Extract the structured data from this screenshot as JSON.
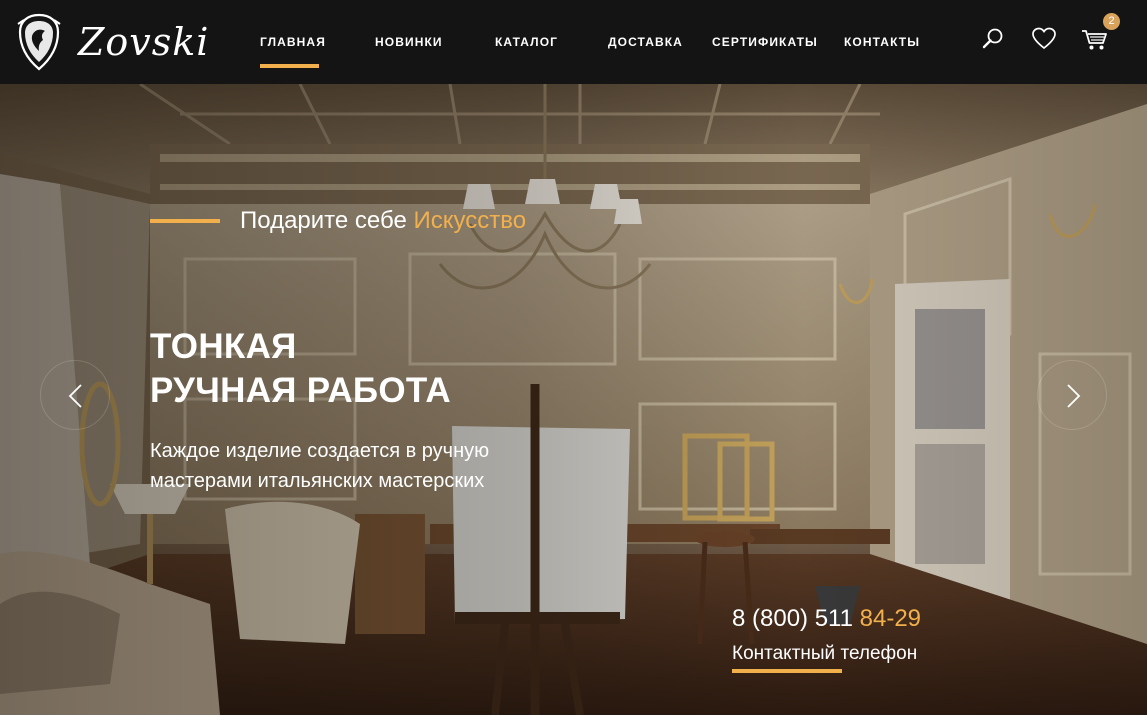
{
  "brand": {
    "name": "Zovski"
  },
  "nav": {
    "items": [
      {
        "label": "ГЛАВНАЯ",
        "active": true
      },
      {
        "label": "НОВИНКИ",
        "active": false
      },
      {
        "label": "КАТАЛОГ",
        "active": false
      },
      {
        "label": "ДОСТАВКА",
        "active": false
      },
      {
        "label": "СЕРТИФИКАТЫ",
        "active": false
      },
      {
        "label": "КОНТАКТЫ",
        "active": false
      }
    ]
  },
  "header_icons": {
    "search": "search-icon",
    "favorites": "heart-icon",
    "cart": "cart-icon",
    "cart_count": "2"
  },
  "hero": {
    "tagline_prefix": "Подарите себе ",
    "tagline_accent": "Искусство",
    "title_line1": "ТОНКАЯ",
    "title_line2": "РУЧНАЯ РАБОТА",
    "subtitle_line1": "Каждое изделие создается в ручную",
    "subtitle_line2": "мастерами итальянских мастерских",
    "phone_main": "8 (800) 511 ",
    "phone_accent": "84-29",
    "phone_label": "Контактный телефон",
    "prev_icon": "chevron-left-icon",
    "next_icon": "chevron-right-icon"
  },
  "colors": {
    "accent": "#f2b04c",
    "header_bg": "#141414",
    "badge": "#d9a25b",
    "text": "#ffffff"
  }
}
